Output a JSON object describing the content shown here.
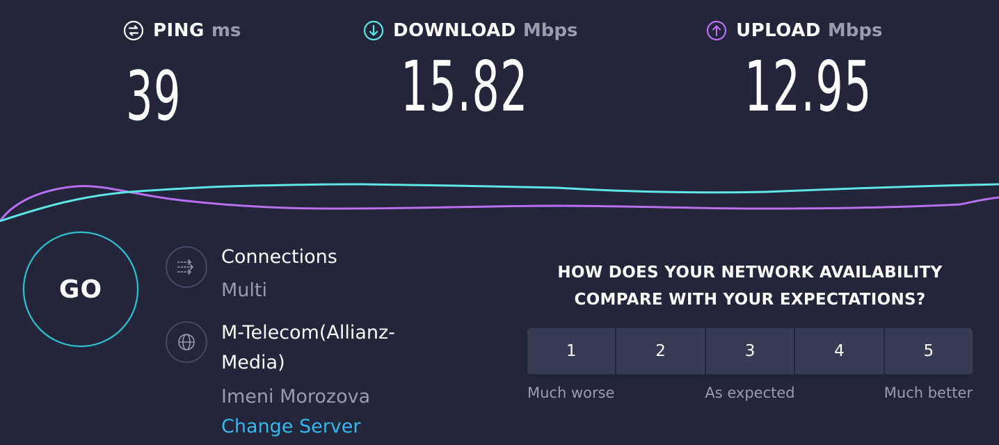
{
  "metrics": {
    "ping": {
      "label": "PING",
      "unit": "ms",
      "value": "39",
      "icon": "ping-icon",
      "color": "#ffffff"
    },
    "download": {
      "label": "DOWNLOAD",
      "unit": "Mbps",
      "value": "15.82",
      "icon": "download-arrow-icon",
      "color": "#5ee6e6"
    },
    "upload": {
      "label": "UPLOAD",
      "unit": "Mbps",
      "value": "12.95",
      "icon": "upload-arrow-icon",
      "color": "#b86ff0"
    }
  },
  "go": {
    "label": "GO"
  },
  "connections": {
    "title": "Connections",
    "value": "Multi",
    "icon": "connections-icon"
  },
  "server": {
    "isp": "M-Telecom(Allianz-Media)",
    "location": "Imeni Morozova",
    "change_label": "Change Server",
    "icon": "globe-icon"
  },
  "survey": {
    "question": "HOW DOES YOUR NETWORK AVAILABILITY COMPARE WITH YOUR EXPECTATIONS?",
    "options": [
      "1",
      "2",
      "3",
      "4",
      "5"
    ],
    "scale": {
      "low": "Much worse",
      "mid": "As expected",
      "high": "Much better"
    }
  },
  "colors": {
    "background": "#23253a",
    "download_line": "#5ee6e6",
    "upload_line": "#b86ff0",
    "link": "#33b9ee",
    "muted_text": "#9a9bad"
  }
}
